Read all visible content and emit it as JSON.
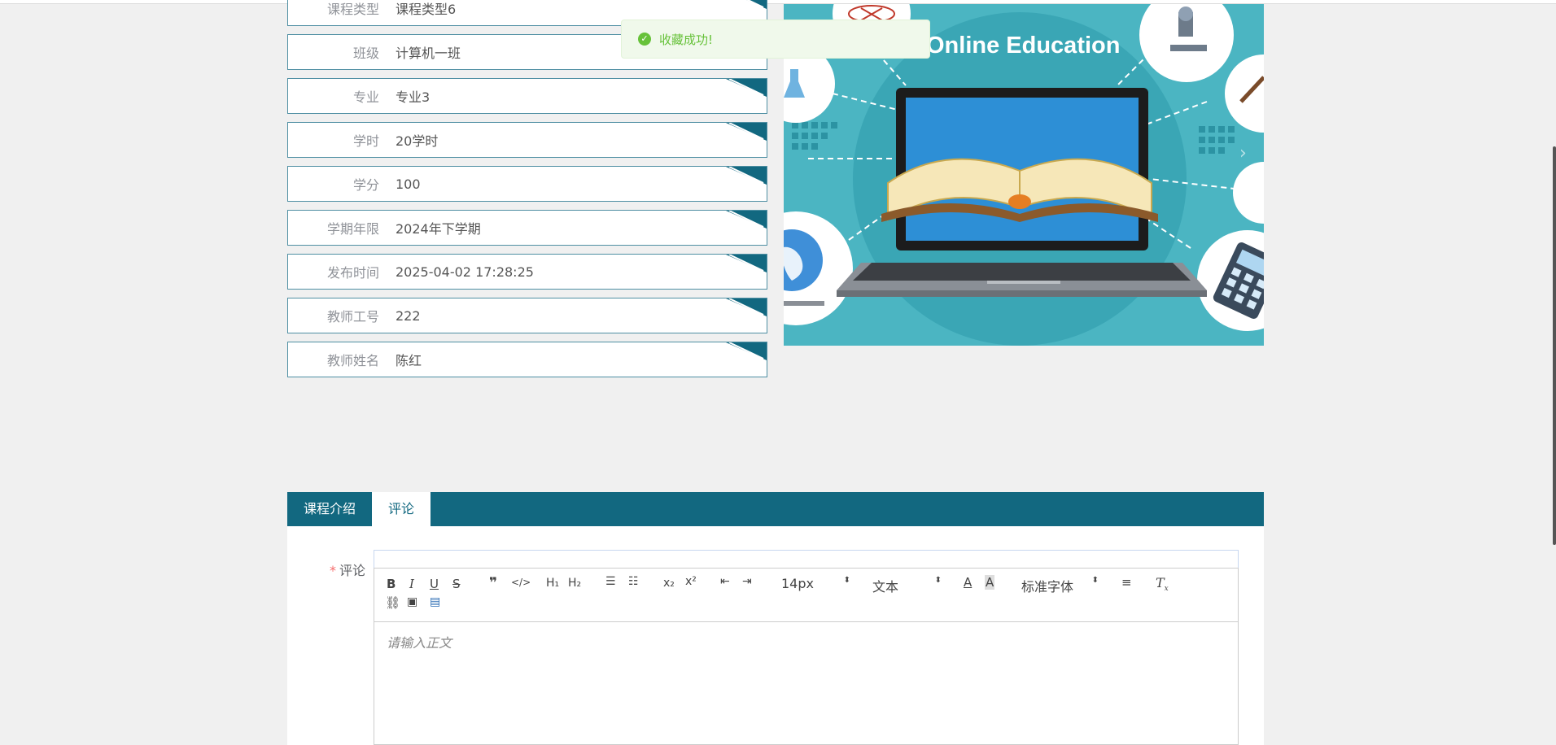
{
  "course_info": {
    "rows": [
      {
        "label": "课程类型",
        "value": "课程类型6"
      },
      {
        "label": "班级",
        "value": "计算机一班"
      },
      {
        "label": "专业",
        "value": "专业3"
      },
      {
        "label": "学时",
        "value": "20学时"
      },
      {
        "label": "学分",
        "value": "100"
      },
      {
        "label": "学期年限",
        "value": "2024年下学期"
      },
      {
        "label": "发布时间",
        "value": "2025-04-02 17:28:25"
      },
      {
        "label": "教师工号",
        "value": "222"
      },
      {
        "label": "教师姓名",
        "value": "陈红"
      }
    ]
  },
  "banner": {
    "headline": "Online Education"
  },
  "toast": {
    "message": "收藏成功!",
    "icon": "check-circle-icon"
  },
  "tabs": [
    {
      "label": "课程介绍"
    },
    {
      "label": "评论"
    }
  ],
  "comment": {
    "label": "评论",
    "required_mark": "*",
    "placeholder": "请输入正文",
    "font_size_value": "14px",
    "block_type_value": "文本",
    "font_family_value": "标准字体"
  },
  "colors": {
    "accent": "#126880",
    "success": "#67c23a",
    "banner_bg": "#3fb3c0"
  }
}
